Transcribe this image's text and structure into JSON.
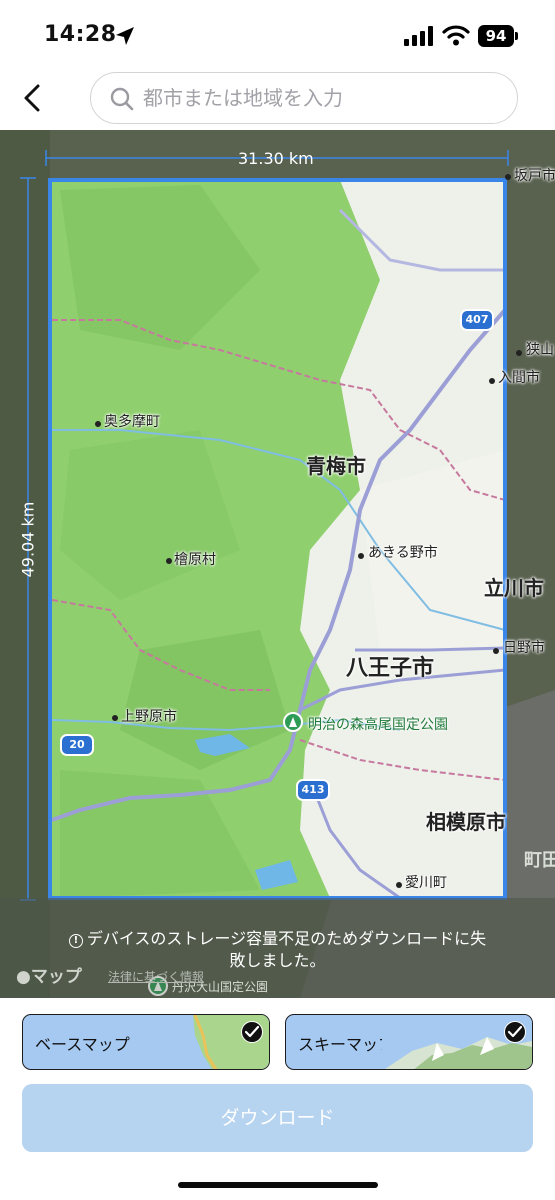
{
  "status_bar": {
    "time": "14:28",
    "battery": "94"
  },
  "search": {
    "placeholder": "都市または地域を入力",
    "value": ""
  },
  "map": {
    "width_label": "31.30 km",
    "height_label": "49.04 km",
    "places": {
      "okutama": "奥多摩町",
      "hinohara": "檜原村",
      "uenohara": "上野原市",
      "ome": "青梅市",
      "akiruno": "あきる野市",
      "hachioji": "八王子市",
      "tachikawa": "立川市",
      "hino": "日野市",
      "sagamihara": "相模原市",
      "aikawa": "愛川町",
      "machida": "町田",
      "sayama": "狭山",
      "iruma": "入間市",
      "sakado": "坂戸市",
      "park": "明治の森高尾国定公園",
      "tanzawa": "丹沢大山国定公園"
    },
    "route_shields": {
      "r407": "407",
      "r20": "20",
      "r413": "413"
    },
    "error_line1": "デバイスのストレージ容量不足のためダウンロードに失",
    "error_line2": "敗しました。",
    "attribution": "マップ",
    "legal_link": "法律に基づく情報"
  },
  "options": {
    "base_map_label": "ベースマップ",
    "ski_map_label": "スキーマップ",
    "base_map_selected": true,
    "ski_map_selected": true
  },
  "download_label": "ダウンロード",
  "colors": {
    "selection": "#3a86e8",
    "card_bg": "#a6c9f2",
    "download_disabled": "#b6d3ef",
    "forest": "#8fcf6e"
  }
}
